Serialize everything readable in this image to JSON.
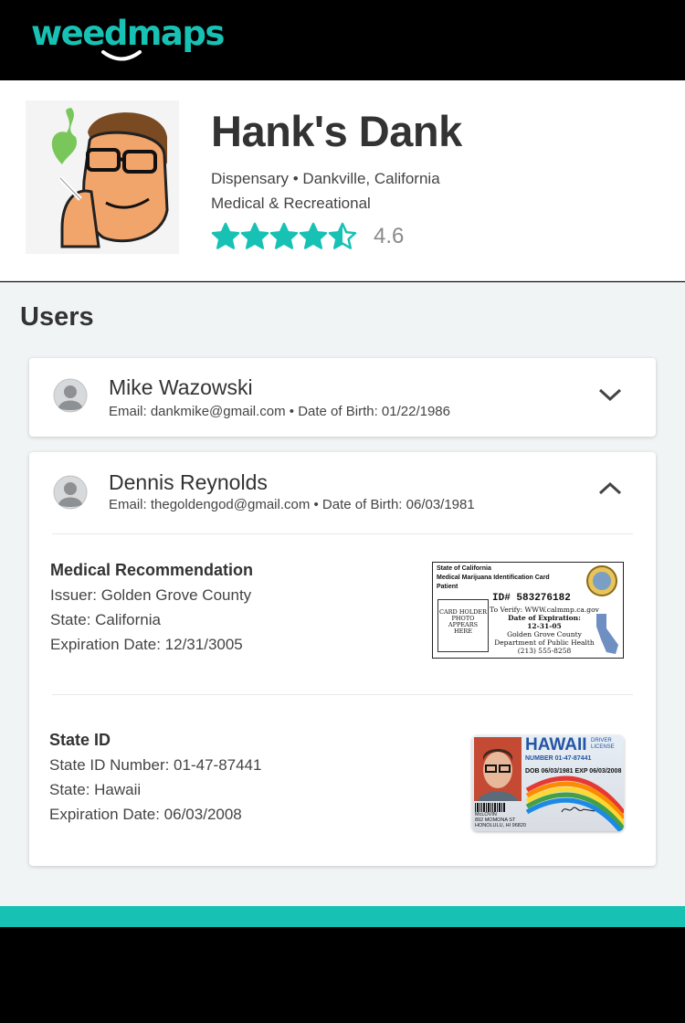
{
  "brand": {
    "logo_text": "weedmaps",
    "accent": "#17c2b5"
  },
  "store": {
    "name": "Hank's Dank",
    "meta_line1": "Dispensary • Dankville, California",
    "meta_line2": "Medical & Recreational",
    "rating": 4.6,
    "rating_text": "4.6",
    "star_color": "#17c2b5"
  },
  "users_section": {
    "title": "Users"
  },
  "users": [
    {
      "name": "Mike Wazowski",
      "info": "Email: dankmike@gmail.com • Date of Birth: 01/22/1986",
      "expanded": false
    },
    {
      "name": "Dennis Reynolds",
      "info": "Email: thegoldengod@gmail.com • Date of Birth: 06/03/1981",
      "expanded": true,
      "medical": {
        "title": "Medical Recommendation",
        "issuer": "Issuer: Golden Grove County",
        "state": "State: California",
        "expiration": "Expiration Date: 12/31/3005",
        "card": {
          "header1": "State of California",
          "header2": "Medical Marijuana Identification Card",
          "header3": "Patient",
          "id": "ID# 583276182",
          "verify": "To Verify: WWW.calmmp.ca.gov",
          "exp_label": "Date of Expiration:",
          "exp_value": "12-31-05",
          "county": "Golden Grove County",
          "dept": "Department of Public Health",
          "phone": "(213) 555-8258",
          "photo_text": "CARD HOLDER PHOTO APPEARS HERE"
        }
      },
      "state_id": {
        "title": "State ID",
        "number": "State ID Number: 01-47-87441",
        "state": "State: Hawaii",
        "expiration": "Expiration Date: 06/03/2008",
        "card": {
          "state": "HAWAII",
          "sub": "DRIVER LICENSE",
          "number": "NUMBER 01-47-87441",
          "dob": "DOB 06/03/1981 EXP 06/03/2008",
          "name": "McLOVIN",
          "address1": "892 MOMONA ST",
          "address2": "HONOLULU, HI 96820"
        }
      }
    }
  ]
}
